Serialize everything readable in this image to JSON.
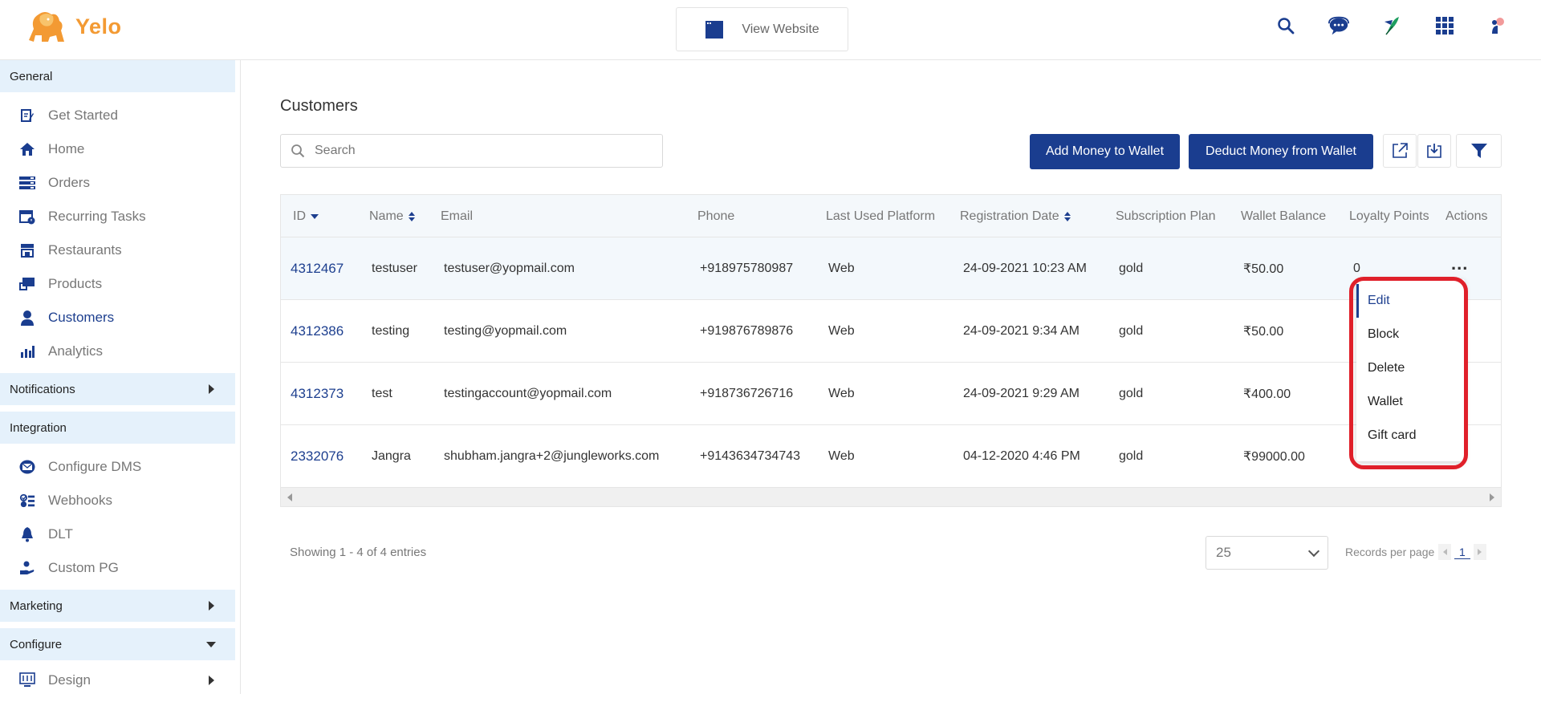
{
  "header": {
    "logo_text": "Yelo",
    "view_website_label": "View Website",
    "icons": [
      "search-icon",
      "chat-support-icon",
      "feather-icon",
      "apps-grid-icon",
      "profile-icon"
    ]
  },
  "sidebar": {
    "sections": {
      "general": "General",
      "notifications": "Notifications",
      "integration": "Integration",
      "marketing": "Marketing",
      "configure": "Configure"
    },
    "general_items": [
      "Get Started",
      "Home",
      "Orders",
      "Recurring Tasks",
      "Restaurants",
      "Products",
      "Customers",
      "Analytics"
    ],
    "integration_items": [
      "Configure DMS",
      "Webhooks",
      "DLT",
      "Custom PG"
    ],
    "configure_items": [
      "Design"
    ],
    "active_item": "Customers"
  },
  "main": {
    "title": "Customers",
    "search_placeholder": "Search",
    "add_money_label": "Add Money to Wallet",
    "deduct_money_label": "Deduct Money from Wallet"
  },
  "table": {
    "columns": [
      "ID",
      "Name",
      "Email",
      "Phone",
      "Last Used Platform",
      "Registration Date",
      "Subscription Plan",
      "Wallet Balance",
      "Loyalty Points",
      "Actions"
    ],
    "rows": [
      [
        "4312467",
        "testuser",
        "testuser@yopmail.com",
        "+918975780987",
        "Web",
        "24-09-2021 10:23 AM",
        "gold",
        "₹50.00",
        "0"
      ],
      [
        "4312386",
        "testing",
        "testing@yopmail.com",
        "+919876789876",
        "Web",
        "24-09-2021 9:34 AM",
        "gold",
        "₹50.00",
        ""
      ],
      [
        "4312373",
        "test",
        "testingaccount@yopmail.com",
        "+918736726716",
        "Web",
        "24-09-2021 9:29 AM",
        "gold",
        "₹400.00",
        ""
      ],
      [
        "2332076",
        "Jangra",
        "shubham.jangra+2@jungleworks.com",
        "+9143634734743",
        "Web",
        "04-12-2020 4:46 PM",
        "gold",
        "₹99000.00",
        ""
      ]
    ],
    "actions_glyph": "..."
  },
  "action_menu": {
    "items": [
      "Edit",
      "Block",
      "Delete",
      "Wallet",
      "Gift card"
    ],
    "active": "Edit"
  },
  "footer": {
    "entries_text": "Showing 1 - 4 of 4 entries",
    "per_page_value": "25",
    "records_label": "Records per page",
    "current_page": "1"
  },
  "colors": {
    "primary": "#1a3d8f",
    "logo": "#f39a33",
    "section_bg": "#e5f1fb",
    "highlight": "#e0202a"
  }
}
